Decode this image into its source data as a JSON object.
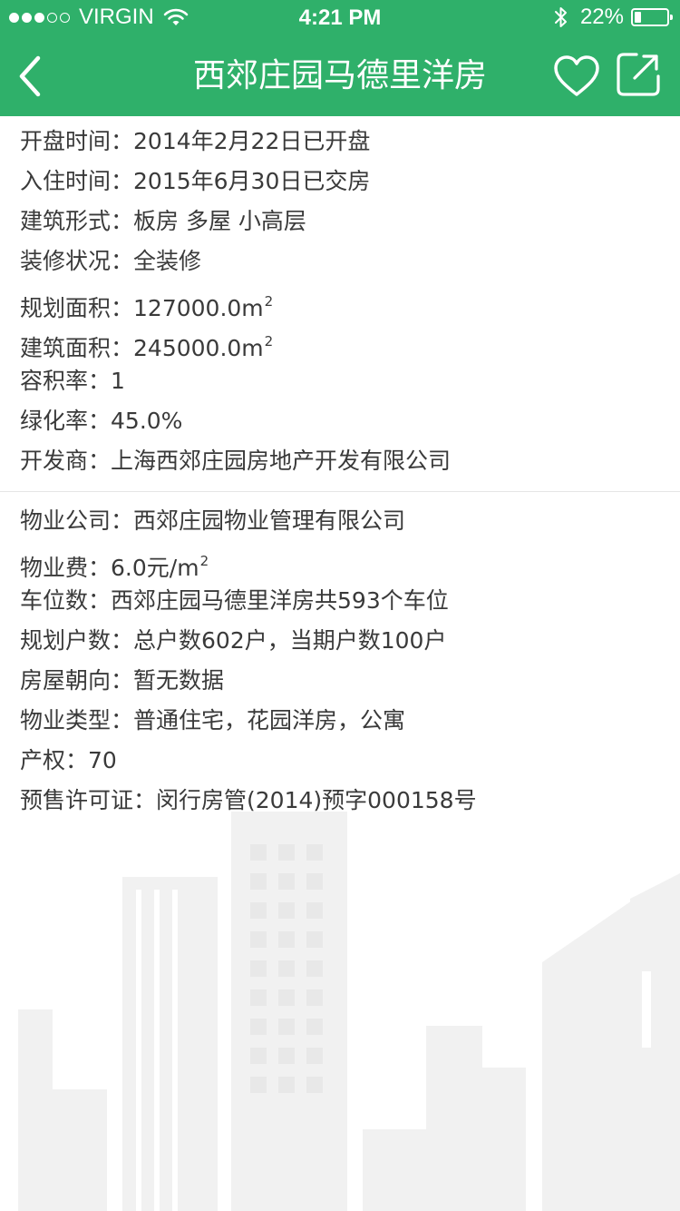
{
  "status_bar": {
    "carrier": "VIRGIN",
    "time": "4:21 PM",
    "battery": "22%",
    "battery_level": 0.22,
    "signal_bars_filled": 3,
    "signal_bars_total": 5
  },
  "nav": {
    "title": "西郊庄园马德里洋房",
    "back_icon": "chevron-left-icon",
    "fav_icon": "heart-icon",
    "share_icon": "share-icon"
  },
  "colors": {
    "accent": "#2fb06a"
  },
  "section1": [
    {
      "label": "开盘时间：",
      "value": "2014年2月22日已开盘",
      "sup": ""
    },
    {
      "label": "入住时间：",
      "value": "2015年6月30日已交房",
      "sup": ""
    },
    {
      "label": "建筑形式：",
      "value": "板房   多屋   小高层",
      "sup": ""
    },
    {
      "label": "装修状况：",
      "value": "全装修",
      "sup": ""
    },
    {
      "label": "规划面积：",
      "value": "127000.0m",
      "sup": "2"
    },
    {
      "label": "建筑面积：",
      "value": "245000.0m",
      "sup": "2"
    },
    {
      "label": "容积率：",
      "value": "1",
      "sup": ""
    },
    {
      "label": "绿化率：",
      "value": "45.0%",
      "sup": ""
    },
    {
      "label": "开发商：",
      "value": "上海西郊庄园房地产开发有限公司",
      "sup": ""
    }
  ],
  "section2": [
    {
      "label": "物业公司：",
      "value": "西郊庄园物业管理有限公司",
      "sup": ""
    },
    {
      "label": "物业费：",
      "value": "6.0元/m",
      "sup": "2"
    },
    {
      "label": "车位数：",
      "value": "西郊庄园马德里洋房共593个车位",
      "sup": ""
    },
    {
      "label": "规划户数：",
      "value": "总户数602户，当期户数100户",
      "sup": ""
    },
    {
      "label": "房屋朝向：",
      "value": "暂无数据",
      "sup": ""
    },
    {
      "label": "物业类型：",
      "value": "普通住宅，花园洋房，公寓",
      "sup": ""
    },
    {
      "label": "产权：",
      "value": "70",
      "sup": ""
    },
    {
      "label": "预售许可证：",
      "value": "闵行房管(2014)预字000158号",
      "sup": ""
    }
  ]
}
